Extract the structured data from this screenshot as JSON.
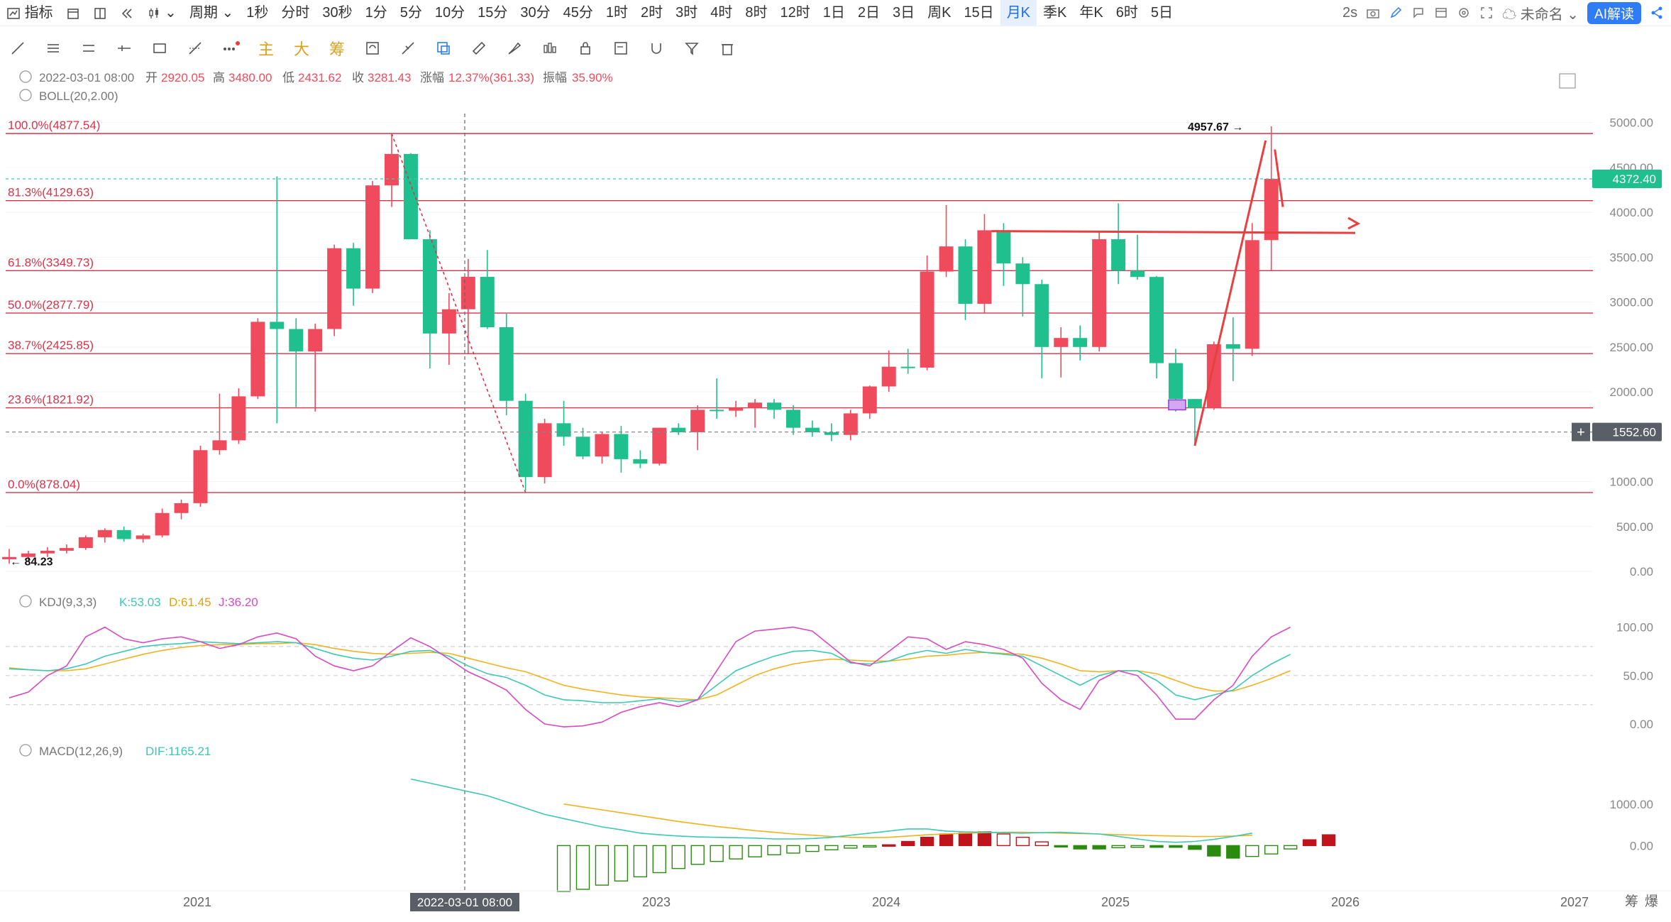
{
  "toolbar": {
    "indicator_label": "指标",
    "period_label": "周期",
    "periods": [
      "1秒",
      "分时",
      "30秒",
      "1分",
      "5分",
      "10分",
      "15分",
      "30分",
      "45分",
      "1时",
      "2时",
      "3时",
      "4时",
      "8时",
      "12时",
      "1日",
      "2日",
      "3日",
      "周K",
      "15日",
      "月K",
      "季K",
      "年K",
      "6时",
      "5日"
    ],
    "active_period": "月K",
    "refresh": "2s",
    "unnamed": "未命名",
    "ai_label": "AI解读"
  },
  "drawtools": [
    "trend-line",
    "parallel-lines",
    "channel",
    "horizontal-ray",
    "rectangle",
    "fib-tool",
    "more"
  ],
  "side_labels": [
    "主",
    "大",
    "筹"
  ],
  "ohlc": {
    "date": "2022-03-01 08:00",
    "open_label": "开",
    "open": "2920.05",
    "high_label": "高",
    "high": "3480.00",
    "low_label": "低",
    "low": "2431.62",
    "close_label": "收",
    "close": "3281.43",
    "change_label": "涨幅",
    "change": "12.37%(361.33)",
    "amp_label": "振幅",
    "amp": "35.90%"
  },
  "boll_label": "BOLL(20,2.00)",
  "kdj": {
    "label": "KDJ(9,3,3)",
    "k": "K:53.03",
    "d": "D:61.45",
    "j": "J:36.20"
  },
  "macd": {
    "label": "MACD(12,26,9)",
    "dif": "DIF:1165.21"
  },
  "price_tags": {
    "current": "4372.40",
    "crosshair": "1552.60",
    "high_marker": "4957.67 →",
    "low_marker": "← 84.23"
  },
  "crosshair_date": "2022-03-01 08:00",
  "footer_right": [
    "筹",
    "爆"
  ],
  "colors": {
    "up": "#ef4b5c",
    "down": "#1fbf8e",
    "fib": "#d9334a",
    "k": "#3cc8b4",
    "d": "#f0b21e",
    "j": "#d64bc1"
  },
  "chart_data": [
    {
      "type": "candlestick",
      "title": "",
      "x_ticks": [
        "2021",
        "2023",
        "2024",
        "2025",
        "2026",
        "2027"
      ],
      "y_ticks": [
        0,
        500,
        1000,
        1500,
        2000,
        2500,
        3000,
        3500,
        4000,
        4500,
        5000
      ],
      "ylim": [
        0,
        5100
      ],
      "fibonacci": [
        {
          "label": "100.0%(4877.54)",
          "value": 4877.54
        },
        {
          "label": "81.3%(4129.63)",
          "value": 4129.63
        },
        {
          "label": "61.8%(3349.73)",
          "value": 3349.73
        },
        {
          "label": "50.0%(2877.79)",
          "value": 2877.79
        },
        {
          "label": "38.7%(2425.85)",
          "value": 2425.85
        },
        {
          "label": "23.6%(1821.92)",
          "value": 1821.92
        },
        {
          "label": "0.0%(878.04)",
          "value": 878.04
        }
      ],
      "candles": [
        {
          "o": 135,
          "h": 250,
          "l": 84.23,
          "c": 160
        },
        {
          "o": 160,
          "h": 230,
          "l": 120,
          "c": 200
        },
        {
          "o": 200,
          "h": 270,
          "l": 160,
          "c": 230
        },
        {
          "o": 230,
          "h": 300,
          "l": 200,
          "c": 260
        },
        {
          "o": 260,
          "h": 400,
          "l": 240,
          "c": 380
        },
        {
          "o": 380,
          "h": 480,
          "l": 320,
          "c": 460
        },
        {
          "o": 460,
          "h": 500,
          "l": 330,
          "c": 360
        },
        {
          "o": 360,
          "h": 420,
          "l": 320,
          "c": 400
        },
        {
          "o": 400,
          "h": 700,
          "l": 380,
          "c": 650
        },
        {
          "o": 650,
          "h": 800,
          "l": 580,
          "c": 760
        },
        {
          "o": 760,
          "h": 1400,
          "l": 720,
          "c": 1350
        },
        {
          "o": 1350,
          "h": 1980,
          "l": 1300,
          "c": 1460
        },
        {
          "o": 1460,
          "h": 2040,
          "l": 1420,
          "c": 1950
        },
        {
          "o": 1950,
          "h": 2820,
          "l": 1920,
          "c": 2780
        },
        {
          "o": 2780,
          "h": 4400,
          "l": 1650,
          "c": 2700
        },
        {
          "o": 2700,
          "h": 2820,
          "l": 1830,
          "c": 2450
        },
        {
          "o": 2450,
          "h": 2760,
          "l": 1780,
          "c": 2700
        },
        {
          "o": 2700,
          "h": 3640,
          "l": 2620,
          "c": 3600
        },
        {
          "o": 3600,
          "h": 3660,
          "l": 2960,
          "c": 3150
        },
        {
          "o": 3150,
          "h": 4350,
          "l": 3100,
          "c": 4300
        },
        {
          "o": 4300,
          "h": 4880,
          "l": 4060,
          "c": 4650
        },
        {
          "o": 4650,
          "h": 4660,
          "l": 3750,
          "c": 3700
        },
        {
          "o": 3700,
          "h": 3800,
          "l": 2260,
          "c": 2650
        },
        {
          "o": 2650,
          "h": 3100,
          "l": 2300,
          "c": 2920
        },
        {
          "o": 2920.05,
          "h": 3480,
          "l": 2431.62,
          "c": 3281.43
        },
        {
          "o": 3281,
          "h": 3580,
          "l": 2700,
          "c": 2720
        },
        {
          "o": 2720,
          "h": 2880,
          "l": 1740,
          "c": 1900
        },
        {
          "o": 1900,
          "h": 1980,
          "l": 900,
          "c": 1050
        },
        {
          "o": 1050,
          "h": 1700,
          "l": 980,
          "c": 1650
        },
        {
          "o": 1650,
          "h": 1900,
          "l": 1400,
          "c": 1500
        },
        {
          "o": 1500,
          "h": 1600,
          "l": 1250,
          "c": 1280
        },
        {
          "o": 1280,
          "h": 1550,
          "l": 1200,
          "c": 1530
        },
        {
          "o": 1530,
          "h": 1620,
          "l": 1100,
          "c": 1250
        },
        {
          "o": 1250,
          "h": 1350,
          "l": 1150,
          "c": 1200
        },
        {
          "o": 1200,
          "h": 1600,
          "l": 1180,
          "c": 1600
        },
        {
          "o": 1600,
          "h": 1650,
          "l": 1520,
          "c": 1550
        },
        {
          "o": 1550,
          "h": 1850,
          "l": 1350,
          "c": 1800
        },
        {
          "o": 1800,
          "h": 2150,
          "l": 1700,
          "c": 1790
        },
        {
          "o": 1790,
          "h": 1900,
          "l": 1720,
          "c": 1820
        },
        {
          "o": 1820,
          "h": 1920,
          "l": 1600,
          "c": 1880
        },
        {
          "o": 1880,
          "h": 1920,
          "l": 1700,
          "c": 1800
        },
        {
          "o": 1800,
          "h": 1850,
          "l": 1520,
          "c": 1600
        },
        {
          "o": 1600,
          "h": 1680,
          "l": 1500,
          "c": 1550
        },
        {
          "o": 1550,
          "h": 1650,
          "l": 1450,
          "c": 1520
        },
        {
          "o": 1520,
          "h": 1800,
          "l": 1460,
          "c": 1760
        },
        {
          "o": 1760,
          "h": 2070,
          "l": 1700,
          "c": 2060
        },
        {
          "o": 2060,
          "h": 2460,
          "l": 2000,
          "c": 2280
        },
        {
          "o": 2280,
          "h": 2480,
          "l": 2200,
          "c": 2270
        },
        {
          "o": 2270,
          "h": 3520,
          "l": 2240,
          "c": 3340
        },
        {
          "o": 3340,
          "h": 4080,
          "l": 3280,
          "c": 3620
        },
        {
          "o": 3620,
          "h": 3700,
          "l": 2800,
          "c": 2980
        },
        {
          "o": 2980,
          "h": 3980,
          "l": 2880,
          "c": 3800
        },
        {
          "o": 3800,
          "h": 3880,
          "l": 3180,
          "c": 3430
        },
        {
          "o": 3430,
          "h": 3500,
          "l": 2840,
          "c": 3200
        },
        {
          "o": 3200,
          "h": 3250,
          "l": 2150,
          "c": 2500
        },
        {
          "o": 2500,
          "h": 2720,
          "l": 2160,
          "c": 2600
        },
        {
          "o": 2600,
          "h": 2740,
          "l": 2350,
          "c": 2500
        },
        {
          "o": 2500,
          "h": 3780,
          "l": 2450,
          "c": 3700
        },
        {
          "o": 3700,
          "h": 4100,
          "l": 3200,
          "c": 3350
        },
        {
          "o": 3350,
          "h": 3750,
          "l": 3250,
          "c": 3280
        },
        {
          "o": 3280,
          "h": 3290,
          "l": 2150,
          "c": 2320
        },
        {
          "o": 2320,
          "h": 2480,
          "l": 1780,
          "c": 1920
        },
        {
          "o": 1920,
          "h": 1920,
          "l": 1400,
          "c": 1820
        },
        {
          "o": 1820,
          "h": 2560,
          "l": 1800,
          "c": 2530
        },
        {
          "o": 2530,
          "h": 2830,
          "l": 2120,
          "c": 2480
        },
        {
          "o": 2480,
          "h": 3880,
          "l": 2400,
          "c": 3690
        },
        {
          "o": 3690,
          "h": 4957.67,
          "l": 3350,
          "c": 4372.4
        }
      ],
      "kdj": {
        "ylim": [
          0,
          110
        ],
        "y_ticks": [
          0,
          50,
          100
        ],
        "k": [
          57,
          56,
          55,
          57,
          62,
          70,
          75,
          80,
          82,
          83,
          85,
          84,
          83,
          84,
          85,
          84,
          78,
          72,
          68,
          66,
          70,
          75,
          76,
          70,
          60,
          52,
          48,
          40,
          30,
          25,
          24,
          22,
          22,
          24,
          26,
          23,
          25,
          40,
          55,
          63,
          70,
          75,
          76,
          73,
          63,
          62,
          65,
          72,
          76,
          73,
          77,
          74,
          72,
          70,
          60,
          50,
          40,
          50,
          55,
          55,
          45,
          30,
          25,
          30,
          35,
          50,
          62,
          72
        ],
        "d": [
          58,
          56,
          55,
          55,
          57,
          62,
          67,
          72,
          76,
          79,
          81,
          82,
          82,
          83,
          83,
          84,
          82,
          78,
          75,
          73,
          72,
          73,
          74,
          73,
          68,
          63,
          58,
          54,
          47,
          40,
          36,
          33,
          30,
          28,
          27,
          26,
          25,
          30,
          40,
          50,
          57,
          62,
          65,
          67,
          66,
          65,
          65,
          67,
          70,
          71,
          73,
          74,
          73,
          72,
          68,
          62,
          55,
          54,
          55,
          55,
          52,
          45,
          38,
          34,
          34,
          40,
          47,
          55
        ],
        "j": [
          27,
          33,
          50,
          60,
          90,
          100,
          88,
          84,
          88,
          90,
          85,
          78,
          82,
          90,
          94,
          88,
          70,
          60,
          55,
          60,
          75,
          89,
          80,
          67,
          54,
          45,
          35,
          15,
          0,
          -3,
          -2,
          2,
          12,
          18,
          22,
          18,
          25,
          55,
          85,
          96,
          98,
          100,
          96,
          80,
          64,
          60,
          75,
          90,
          88,
          77,
          85,
          82,
          77,
          68,
          42,
          25,
          15,
          45,
          55,
          50,
          30,
          5,
          5,
          25,
          40,
          70,
          90,
          100
        ]
      },
      "macd": {
        "ylim": [
          -1000,
          1900
        ],
        "y_ticks": [
          0,
          1000
        ],
        "dif": [
          null,
          null,
          null,
          null,
          null,
          null,
          null,
          null,
          null,
          null,
          null,
          null,
          null,
          null,
          null,
          null,
          null,
          null,
          null,
          null,
          null,
          1600,
          1500,
          1400,
          1300,
          1200,
          1050,
          900,
          750,
          650,
          550,
          450,
          380,
          300,
          260,
          230,
          210,
          200,
          190,
          180,
          160,
          160,
          170,
          200,
          250,
          300,
          350,
          400,
          400,
          350,
          330,
          320,
          310,
          300,
          310,
          320,
          300,
          280,
          220,
          160,
          100,
          80,
          100,
          150,
          220,
          300
        ],
        "dea": [
          null,
          null,
          null,
          null,
          null,
          null,
          null,
          null,
          null,
          null,
          null,
          null,
          null,
          null,
          null,
          null,
          null,
          null,
          null,
          null,
          null,
          null,
          null,
          null,
          null,
          null,
          null,
          null,
          null,
          1000,
          930,
          860,
          790,
          720,
          650,
          580,
          520,
          460,
          410,
          360,
          320,
          280,
          250,
          220,
          200,
          190,
          200,
          230,
          260,
          280,
          300,
          310,
          320,
          320,
          310,
          300,
          290,
          280,
          260,
          250,
          240,
          230,
          220,
          220,
          230,
          250
        ],
        "hist": [
          null,
          null,
          null,
          null,
          null,
          null,
          null,
          null,
          null,
          null,
          null,
          null,
          null,
          null,
          null,
          null,
          null,
          null,
          null,
          null,
          null,
          null,
          null,
          null,
          null,
          null,
          null,
          null,
          null,
          -1100,
          -1050,
          -950,
          -850,
          -750,
          -650,
          -550,
          -450,
          -380,
          -320,
          -270,
          -220,
          -180,
          -140,
          -100,
          -60,
          -30,
          20,
          100,
          200,
          280,
          300,
          330,
          280,
          200,
          90,
          -30,
          -80,
          -80,
          -50,
          -40,
          -40,
          -40,
          -90,
          -250,
          -300,
          -260,
          -200,
          -80,
          140,
          260
        ]
      }
    }
  ]
}
